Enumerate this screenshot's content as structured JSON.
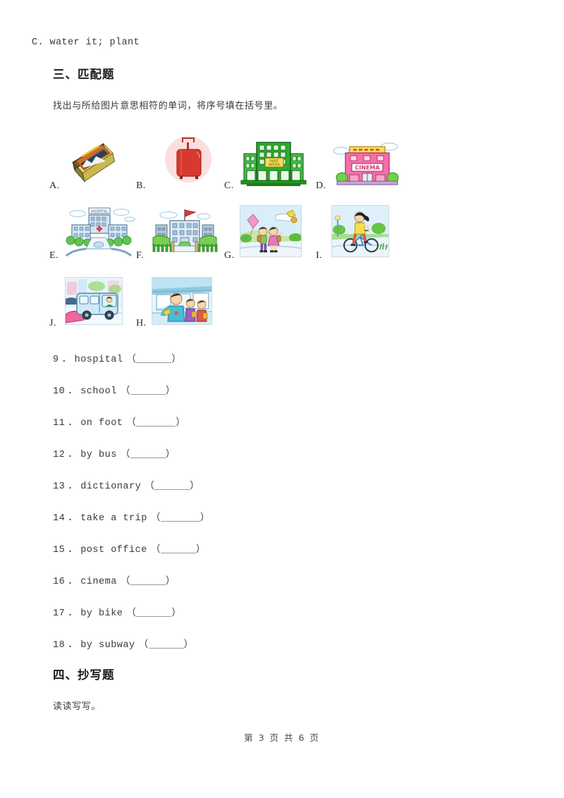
{
  "document": {
    "top_option_line": "C. water it; plant",
    "footer": "第 3 页 共 6 页"
  },
  "section_three": {
    "title": "三、匹配题",
    "instruction": "找出与所给图片意思相符的单词，将序号填在括号里。"
  },
  "section_four": {
    "title": "四、抄写题",
    "instruction": "读读写写。"
  },
  "pictures": [
    {
      "label": "A.",
      "icon": "dictionary-book-icon",
      "meaning": "dictionary"
    },
    {
      "label": "B.",
      "icon": "red-suitcase-icon",
      "meaning": "take a trip"
    },
    {
      "label": "C.",
      "icon": "post-office-icon",
      "meaning": "post office"
    },
    {
      "label": "D.",
      "icon": "cinema-icon",
      "meaning": "cinema"
    },
    {
      "label": "E.",
      "icon": "hospital-icon",
      "meaning": "hospital"
    },
    {
      "label": "F.",
      "icon": "school-icon",
      "meaning": "school"
    },
    {
      "label": "G.",
      "icon": "kids-walking-icon",
      "meaning": "on foot"
    },
    {
      "label": "I.",
      "icon": "girl-on-bike-icon",
      "meaning": "by bike"
    },
    {
      "label": "J.",
      "icon": "bus-icon",
      "meaning": "by bus"
    },
    {
      "label": "H.",
      "icon": "subway-icon",
      "meaning": "by subway"
    }
  ],
  "picture_signs": {
    "post_office": "POST OFFICE",
    "cinema": "CINEMA",
    "hospital": "HOSPITAL"
  },
  "questions": [
    {
      "num": "9",
      "word": "hospital"
    },
    {
      "num": "10",
      "word": "school"
    },
    {
      "num": "11",
      "word": "on foot"
    },
    {
      "num": "12",
      "word": "by bus"
    },
    {
      "num": "13",
      "word": "dictionary"
    },
    {
      "num": "14",
      "word": "take a trip"
    },
    {
      "num": "15",
      "word": "post office"
    },
    {
      "num": "16",
      "word": "cinema"
    },
    {
      "num": "17",
      "word": "by bike"
    },
    {
      "num": "18",
      "word": "by subway"
    }
  ],
  "punctuation": {
    "dot": "．",
    "paren_open": "（",
    "paren_close": "）"
  },
  "colors": {
    "text": "#3a3a3a",
    "heading": "#1a1a1a",
    "blank_rule": "#9a9a9a",
    "post_office_green": "#2eab2e",
    "cinema_pink": "#f570a8",
    "hospital_blue": "#bcd7ea",
    "suitcase_red": "#d6392f"
  }
}
